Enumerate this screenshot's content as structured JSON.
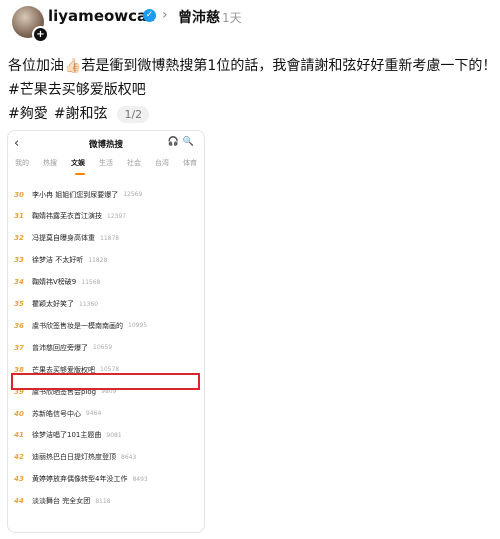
{
  "post": {
    "handle": "liyameowcat",
    "coauthor": "曾沛慈",
    "time": "1天",
    "caption": "各位加油👍🏻若是衝到微博熱搜第1位的話，我會請謝和弦好好重新考慮一下的！",
    "hashtag_line1": "#芒果去买够爱版权吧",
    "hashtag_line2_a": "#夠愛",
    "hashtag_line2_b": "#謝和弦",
    "page_indicator": "1/2"
  },
  "screenshot": {
    "title": "微博热搜",
    "tabs": [
      "我的",
      "热搜",
      "文娱",
      "生活",
      "社会",
      "台湾",
      "体育"
    ],
    "active_tab": "文娱",
    "accent": "#ff8200",
    "highlight_color": "#d9262b",
    "rows": [
      {
        "rank": "30",
        "topic": "李小冉 姐姐们您到尿要爆了",
        "heat": "12569"
      },
      {
        "rank": "31",
        "topic": "鞠婧祎露芜衣首江演技",
        "heat": "12397"
      },
      {
        "rank": "32",
        "topic": "冯提莫自曝身高体重",
        "heat": "11878"
      },
      {
        "rank": "33",
        "topic": "徐梦洁 不太好听",
        "heat": "11828"
      },
      {
        "rank": "34",
        "topic": "鞠婧祎V榜破9",
        "heat": "11568"
      },
      {
        "rank": "35",
        "topic": "瞿颖太好笑了",
        "heat": "11360"
      },
      {
        "rank": "36",
        "topic": "虞书欣签售妆是一模南南画的",
        "heat": "10995"
      },
      {
        "rank": "37",
        "topic": "曾沛慈回应旁爆了",
        "heat": "10659"
      },
      {
        "rank": "38",
        "topic": "芒果去买够爱版权吧",
        "heat": "10578"
      },
      {
        "rank": "39",
        "topic": "虞书欣晒签售会plog",
        "heat": "9809"
      },
      {
        "rank": "40",
        "topic": "苏新皓信号中心",
        "heat": "9464"
      },
      {
        "rank": "41",
        "topic": "徐梦洁唱了101主题曲",
        "heat": "9081"
      },
      {
        "rank": "42",
        "topic": "迪丽热巴白日提灯热度登顶",
        "heat": "8643"
      },
      {
        "rank": "43",
        "topic": "黄婷婷放弃偶像转型4年没工作",
        "heat": "8493"
      },
      {
        "rank": "44",
        "topic": "淡淡舞台 完全女团",
        "heat": "8118"
      }
    ]
  }
}
